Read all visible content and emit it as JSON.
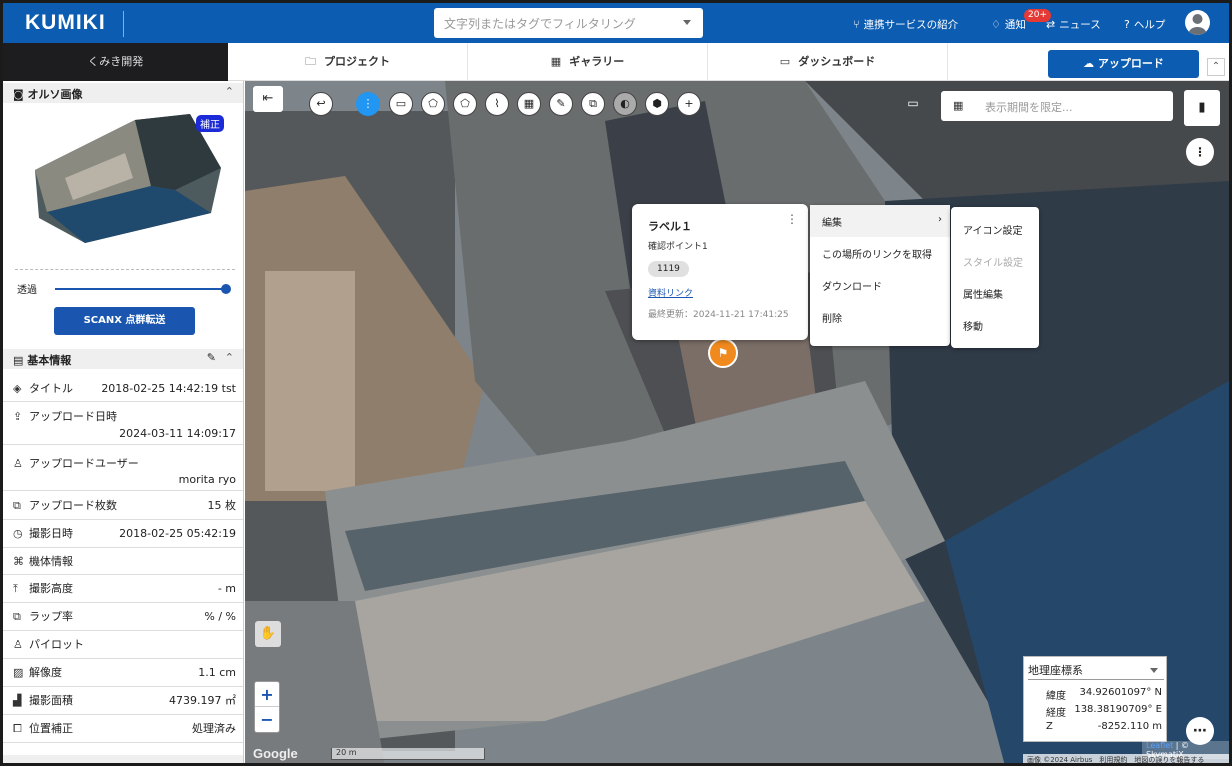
{
  "header": {
    "logo": "KUMIKI",
    "search_placeholder": "文字列またはタグでフィルタリング",
    "links": [
      {
        "icon": "share-icon",
        "label": "連携サービスの紹介"
      },
      {
        "icon": "bell-icon",
        "label": "通知"
      },
      {
        "icon": "news-icon",
        "label": "ニュース"
      },
      {
        "icon": "help-icon",
        "label": "ヘルプ"
      }
    ],
    "notification_badge": "20+"
  },
  "nav": {
    "org": "くみき開発",
    "tabs": [
      {
        "icon": "folder-icon",
        "label": "プロジェクト"
      },
      {
        "icon": "grid-icon",
        "label": "ギャラリー"
      },
      {
        "icon": "monitor-icon",
        "label": "ダッシュボード"
      }
    ],
    "upload_label": "アップロード"
  },
  "sidebar": {
    "ortho_title": "オルソ画像",
    "badge": "補正",
    "transparency_label": "透過",
    "transparency_value": 1.0,
    "scanx_label": "SCANX 点群転送",
    "basic_title": "基本情報",
    "rows": [
      {
        "icon": "layers-icon",
        "label": "タイトル",
        "value": "2018-02-25 14:42:19 tst"
      },
      {
        "icon": "upload-icon",
        "label": "アップロード日時",
        "value": "2024-03-11 14:09:17"
      },
      {
        "icon": "user-icon",
        "label": "アップロードユーザー",
        "value": "morita ryo"
      },
      {
        "icon": "images-icon",
        "label": "アップロード枚数",
        "value": "15 枚"
      },
      {
        "icon": "clock-icon",
        "label": "撮影日時",
        "value": "2018-02-25 05:42:19"
      },
      {
        "icon": "drone-icon",
        "label": "機体情報",
        "value": ""
      },
      {
        "icon": "altitude-icon",
        "label": "撮影高度",
        "value": "- m"
      },
      {
        "icon": "overlap-icon",
        "label": "ラップ率",
        "value": "% / %"
      },
      {
        "icon": "pilot-icon",
        "label": "パイロット",
        "value": ""
      },
      {
        "icon": "resolution-icon",
        "label": "解像度",
        "value": "1.1 cm"
      },
      {
        "icon": "area-icon",
        "label": "撮影面積",
        "value": "4739.197 ㎡"
      },
      {
        "icon": "correction-icon",
        "label": "位置補正",
        "value": "処理済み"
      }
    ]
  },
  "map": {
    "date_filter_placeholder": "表示期間を限定...",
    "popup": {
      "title": "ラベル１",
      "subtitle": "確認ポイント1",
      "chip": "1119",
      "link": "資料リンク",
      "updated": "最終更新：2024-11-21 17:41:25"
    },
    "context_menu": [
      "編集",
      "この場所のリンクを取得",
      "ダウンロード",
      "削除"
    ],
    "submenu": [
      "アイコン設定",
      "スタイル設定",
      "属性編集",
      "移動"
    ],
    "google": "Google",
    "scale": "20 m",
    "coords": {
      "system": "地理座標系",
      "rows": [
        {
          "k": "緯度",
          "v": "34.92601097° N"
        },
        {
          "k": "経度",
          "v": "138.38190709° E"
        },
        {
          "k": "Z",
          "v": "-8252.110 m"
        }
      ]
    },
    "attribution_leaflet": "Leaflet",
    "attribution_rest": " | © SkymatiX",
    "bottom_attribution": "画像 ©2024 Airbus　利用規約　地図の誤りを報告する"
  }
}
